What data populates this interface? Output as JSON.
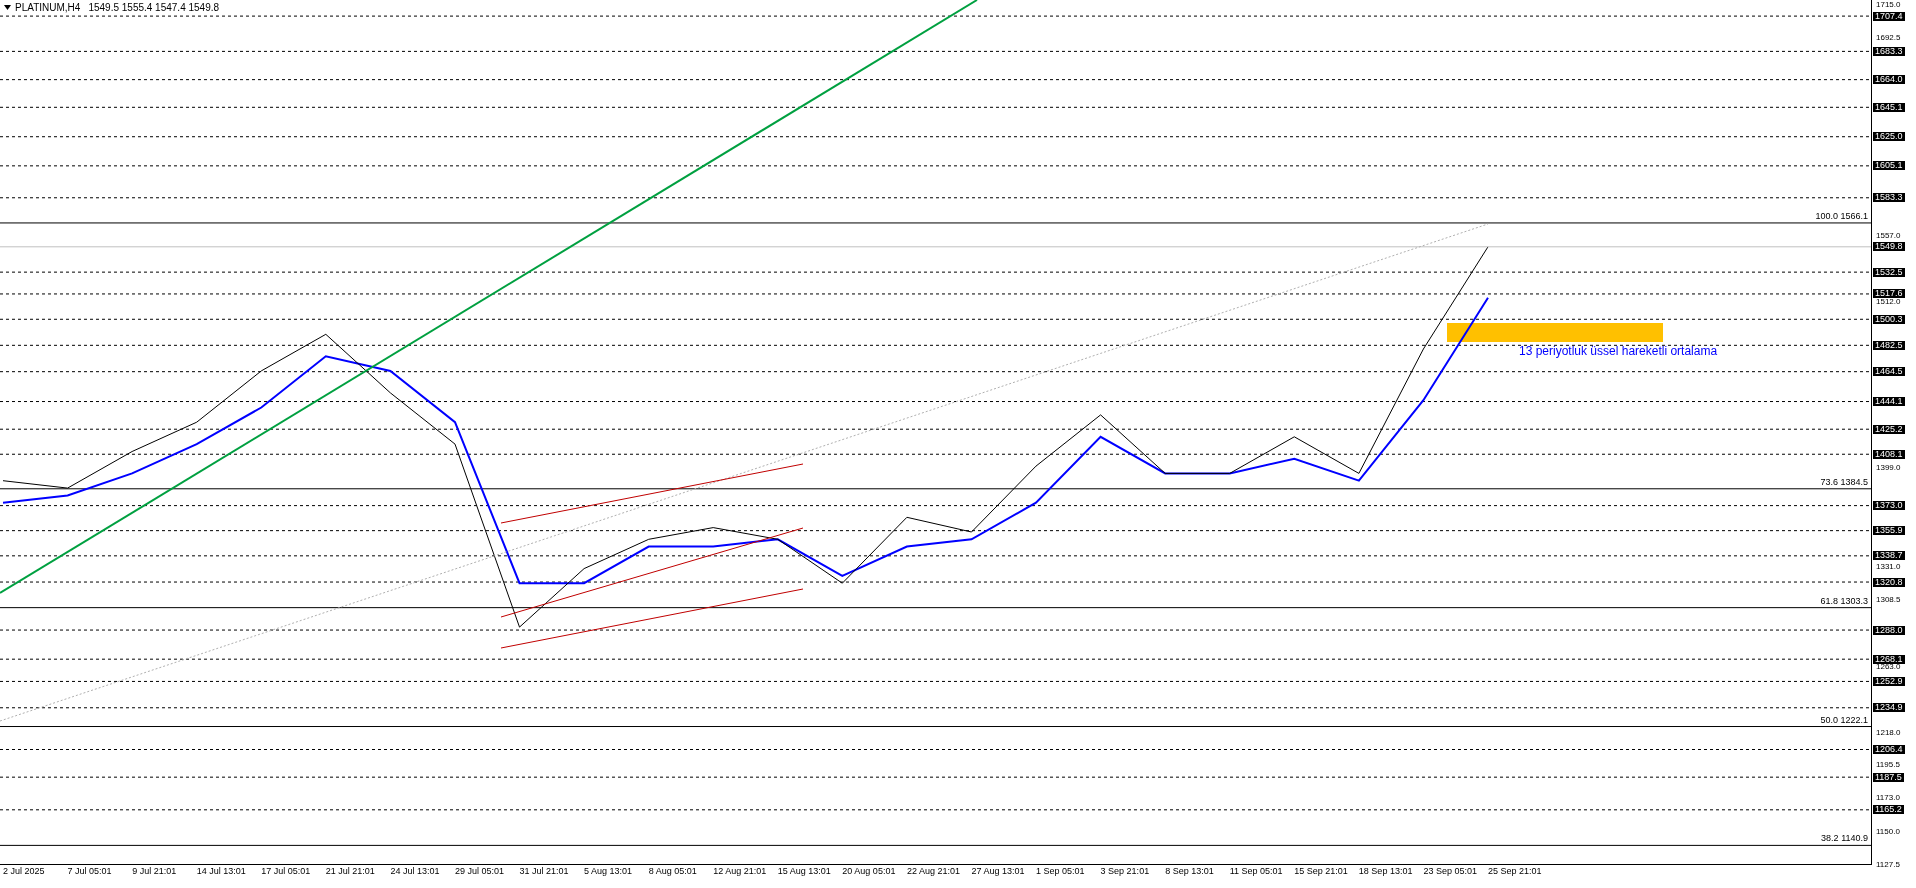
{
  "header": {
    "symbol": "PLATINUM,H4",
    "ohlc": "1549.5 1555.4 1547.4 1549.8"
  },
  "current_price": "1549.8",
  "levels": [
    "1707.4",
    "1683.3",
    "1664.0",
    "1645.1",
    "1625.0",
    "1605.1",
    "1583.3",
    "1532.5",
    "1517.6",
    "1500.3",
    "1482.5",
    "1464.5",
    "1444.1",
    "1425.2",
    "1408.1",
    "1373.0",
    "1355.9",
    "1338.7",
    "1320.8",
    "1288.0",
    "1268.1",
    "1252.9",
    "1234.9",
    "1206.4",
    "1187.5",
    "1165.2"
  ],
  "fibonacci": [
    "100.0 1566.1",
    "73.6 1384.5",
    "61.8 1303.3",
    "50.0 1222.1",
    "38.2 1140.9"
  ],
  "annotation": {
    "text": "13 periyotluk üssel hareketli ortalama",
    "color": "#0000ff"
  },
  "chart_data": {
    "type": "line",
    "categories": [
      "2 Jul 2025",
      "7 Jul 05:01",
      "9 Jul 21:01",
      "14 Jul 13:01",
      "17 Jul 05:01",
      "21 Jul 21:01",
      "24 Jul 13:01",
      "29 Jul 05:01",
      "31 Jul 21:01",
      "5 Aug 13:01",
      "8 Aug 05:01",
      "12 Aug 21:01",
      "15 Aug 13:01",
      "20 Aug 05:01",
      "22 Aug 21:01",
      "27 Aug 13:01",
      "1 Sep 05:01",
      "3 Sep 21:01",
      "8 Sep 13:01",
      "11 Sep 05:01",
      "15 Sep 21:01",
      "18 Sep 13:01",
      "23 Sep 05:01",
      "25 Sep 21:01"
    ],
    "series": [
      {
        "color": "#000000",
        "values": [
          1390,
          1385,
          1410,
          1430,
          1465,
          1490,
          1450,
          1415,
          1290,
          1330,
          1350,
          1358,
          1350,
          1320,
          1365,
          1355,
          1400,
          1435,
          1395,
          1395,
          1420,
          1395,
          1480,
          1549.8
        ]
      },
      {
        "color": "#0000ff",
        "values": [
          1375,
          1380,
          1395,
          1415,
          1440,
          1475,
          1465,
          1430,
          1320,
          1320,
          1345,
          1345,
          1350,
          1325,
          1345,
          1350,
          1375,
          1420,
          1395,
          1395,
          1405,
          1390,
          1445,
          1515
        ]
      }
    ],
    "ylim": [
      1127.5,
      1718.4
    ],
    "yticks": [
      {
        "value": 1715,
        "label": "1715.0"
      },
      {
        "value": 1692.5,
        "label": "1692.5"
      },
      {
        "value": 1557,
        "label": "1557.0"
      },
      {
        "value": 1512,
        "label": "1512.0"
      },
      {
        "value": 1399,
        "label": "1399.0"
      },
      {
        "value": 1331,
        "label": "1331.0"
      },
      {
        "value": 1308.5,
        "label": "1308.5"
      },
      {
        "value": 1263,
        "label": "1263.0"
      },
      {
        "value": 1218,
        "label": "1218.0"
      },
      {
        "value": 1195.5,
        "label": "1195.5"
      },
      {
        "value": 1173,
        "label": "1173.0"
      },
      {
        "value": 1150,
        "label": "1150.0"
      },
      {
        "value": 1127.5,
        "label": "1127.5"
      }
    ]
  }
}
